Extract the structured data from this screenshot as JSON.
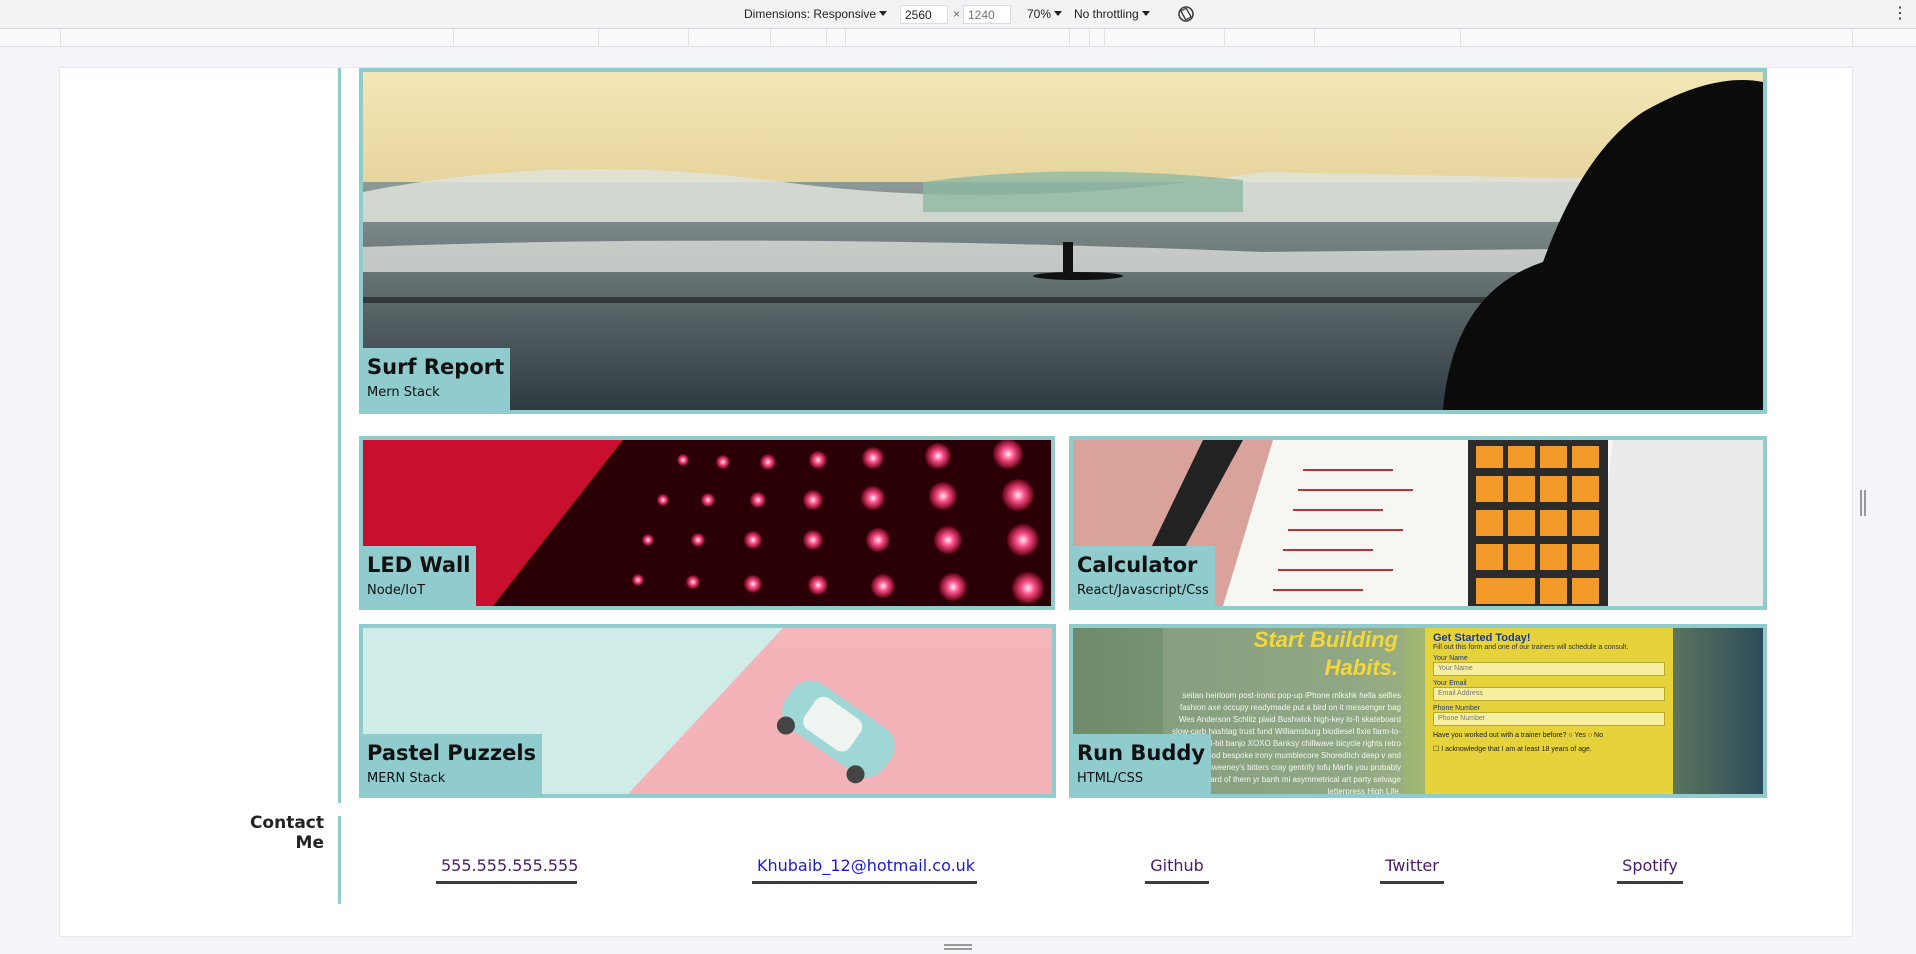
{
  "devtools": {
    "dimensions_label": "Dimensions: Responsive",
    "width_value": "2560",
    "times": "×",
    "height_placeholder": "1240",
    "zoom": "70%",
    "throttling": "No throttling",
    "rotate_icon": "rotate-icon",
    "more_icon": "more-vertical-icon"
  },
  "projects": [
    {
      "title": "Surf Report",
      "stack": "Mern Stack"
    },
    {
      "title": "LED Wall",
      "stack": "Node/IoT"
    },
    {
      "title": "Calculator",
      "stack": "React/Javascript/Css"
    },
    {
      "title": "Pastel Puzzels",
      "stack": "MERN Stack"
    },
    {
      "title": "Run Buddy",
      "stack": "HTML/CSS"
    }
  ],
  "run_buddy_preview": {
    "headline_1": "Start Building",
    "headline_2": "Habits.",
    "form_title": "Get Started Today!",
    "form_sub": "Fill out this form and one of our trainers will schedule a consult.",
    "name_label": "Your Name",
    "name_placeholder": "Your Name",
    "email_label": "Your Email",
    "email_placeholder": "Email Address",
    "phone_label": "Phone Number",
    "phone_placeholder": "Phone Number",
    "question": "Have you worked out with a trainer before?",
    "yes": "Yes",
    "no": "No",
    "ack": "I acknowledge that I am at least 18 years of age."
  },
  "contact": {
    "title": "Contact Me",
    "links": [
      "555.555.555.555",
      "Khubaib_12@hotmail.co.uk",
      "Github",
      "Twitter",
      "Spotify"
    ]
  },
  "colors": {
    "accent": "#90cbce",
    "link": "#4a1a6a",
    "email_link": "#1a1adb"
  }
}
